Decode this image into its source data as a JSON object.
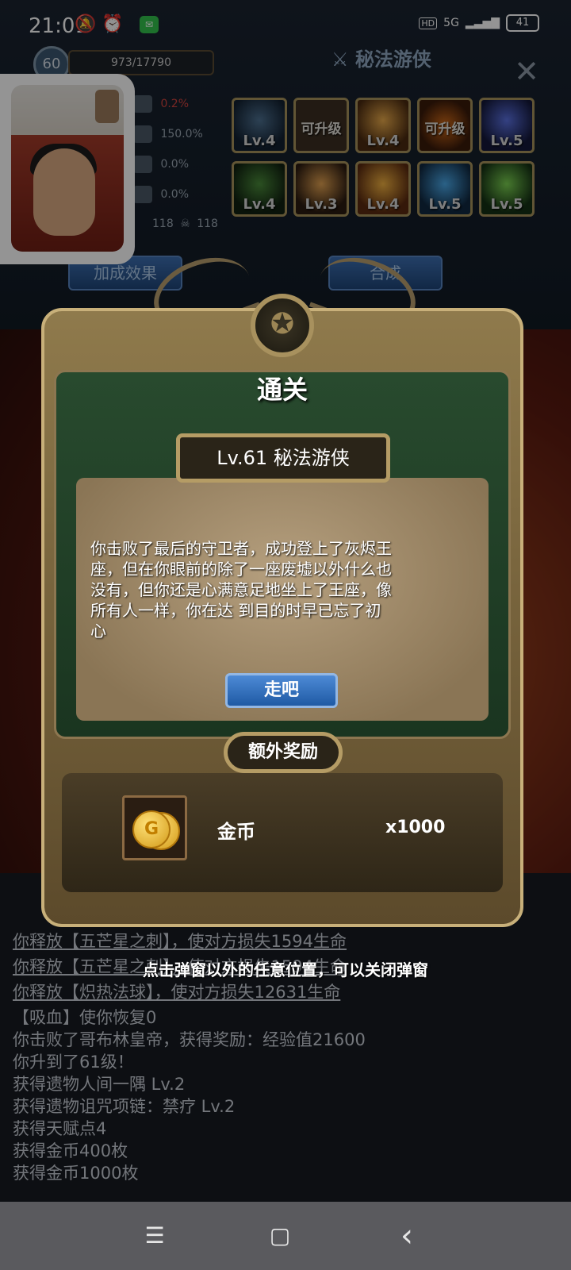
{
  "statusbar": {
    "time": "21:01",
    "network": "5G",
    "hd": "HD",
    "battery": "41"
  },
  "player": {
    "level": "60",
    "exp": "973/17790",
    "class_title": "秘法游侠"
  },
  "stats": [
    {
      "value": "0.2%",
      "color": "#d0433e"
    },
    {
      "value": "150.0%"
    },
    {
      "value": "0.0%"
    },
    {
      "value": "0.0%"
    },
    {
      "value": "118"
    }
  ],
  "stat_extra": "118",
  "skills": [
    {
      "label": "Lv.4"
    },
    {
      "label": "可升级"
    },
    {
      "label": "Lv.4"
    },
    {
      "label": "可升级"
    },
    {
      "label": "Lv.5"
    },
    {
      "label": "Lv.4"
    },
    {
      "label": "Lv.3"
    },
    {
      "label": "Lv.4"
    },
    {
      "label": "Lv.5"
    },
    {
      "label": "Lv.5"
    }
  ],
  "buttons": {
    "bonus": "加成效果",
    "fuse": "合成"
  },
  "modal": {
    "title": "通关",
    "level_line": "Lv.61  秘法游侠",
    "story": "你击败了最后的守卫者，成功登上了灰烬王座，但在你眼前的除了一座废墟以外什么也没有，但你还是心满意足地坐上了王座，像所有人一样，你在达 到目的时早已忘了初心",
    "go_label": "走吧",
    "reward_title": "额外奖励",
    "reward_name": "金币",
    "reward_qty": "x1000",
    "coin_glyph": "G"
  },
  "hint": "点击弹窗以外的任意位置，可以关闭弹窗",
  "log": [
    "你释放【五芒星之刺】，使对方损失1594生命",
    "你释放【五芒星之刺】，使对方损失1594生命",
    "你释放【炽热法球】，使对方损失12631生命",
    "【吸血】使你恢复0",
    "你击败了哥布林皇帝，获得奖励：经验值21600",
    "你升到了61级！",
    "获得遗物人间一隅 Lv.2",
    "获得遗物诅咒项链：禁疗 Lv.2",
    "获得天赋点4",
    "获得金币400枚",
    "获得金币1000枚"
  ],
  "log_underlined": [
    true,
    true,
    true,
    false,
    false,
    false,
    false,
    false,
    false,
    false,
    false
  ],
  "navbar": {
    "menu": "☰",
    "home": "▢",
    "back": "‹"
  }
}
